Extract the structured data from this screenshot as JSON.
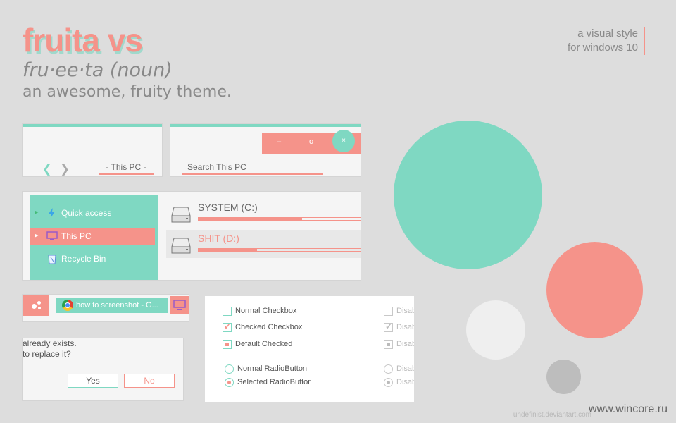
{
  "hero": {
    "title": "fruita vs",
    "pronunciation": "fru·ee·ta (noun)",
    "tagline": "an awesome, fruity theme.",
    "style_line1": "a visual style",
    "style_line2": "for windows 10"
  },
  "colors": {
    "mint": "#7fd8c2",
    "coral": "#f5938a",
    "background": "#dddddd",
    "panel": "#f5f5f5"
  },
  "navigation": {
    "back_icon": "chevron-left-icon",
    "forward_icon": "chevron-right-icon",
    "location": "This PC"
  },
  "titlebar": {
    "minimize": "–",
    "maximize": "o",
    "close": "×",
    "search_placeholder": "Search This PC"
  },
  "explorer": {
    "sidebar": [
      {
        "label": "Quick access",
        "icon": "lightning-icon"
      },
      {
        "label": "This PC",
        "icon": "monitor-icon",
        "selected": true
      },
      {
        "label": "Recycle Bin",
        "icon": "recycle-bin-icon"
      }
    ],
    "drives": [
      {
        "name": "SYSTEM (C:)",
        "used_fraction": 0.64
      },
      {
        "name": "SHIT (D:)",
        "used_fraction": 0.36,
        "selected": true
      }
    ]
  },
  "taskbar": {
    "tab_title": "how to screenshot - G..."
  },
  "dialog": {
    "line1": "already exists.",
    "line2": "to replace it?",
    "yes": "Yes",
    "no": "No"
  },
  "controls": {
    "normal_checkbox": "Normal Checkbox",
    "checked_checkbox": "Checked Checkbox",
    "default_checked": "Default Checked",
    "normal_radio": "Normal RadioButton",
    "selected_radio": "Selected RadioButtor",
    "disabled": "Disab"
  },
  "footer": {
    "watermark": "www.wincore.ru",
    "credit": "undefinist.deviantart.com"
  }
}
